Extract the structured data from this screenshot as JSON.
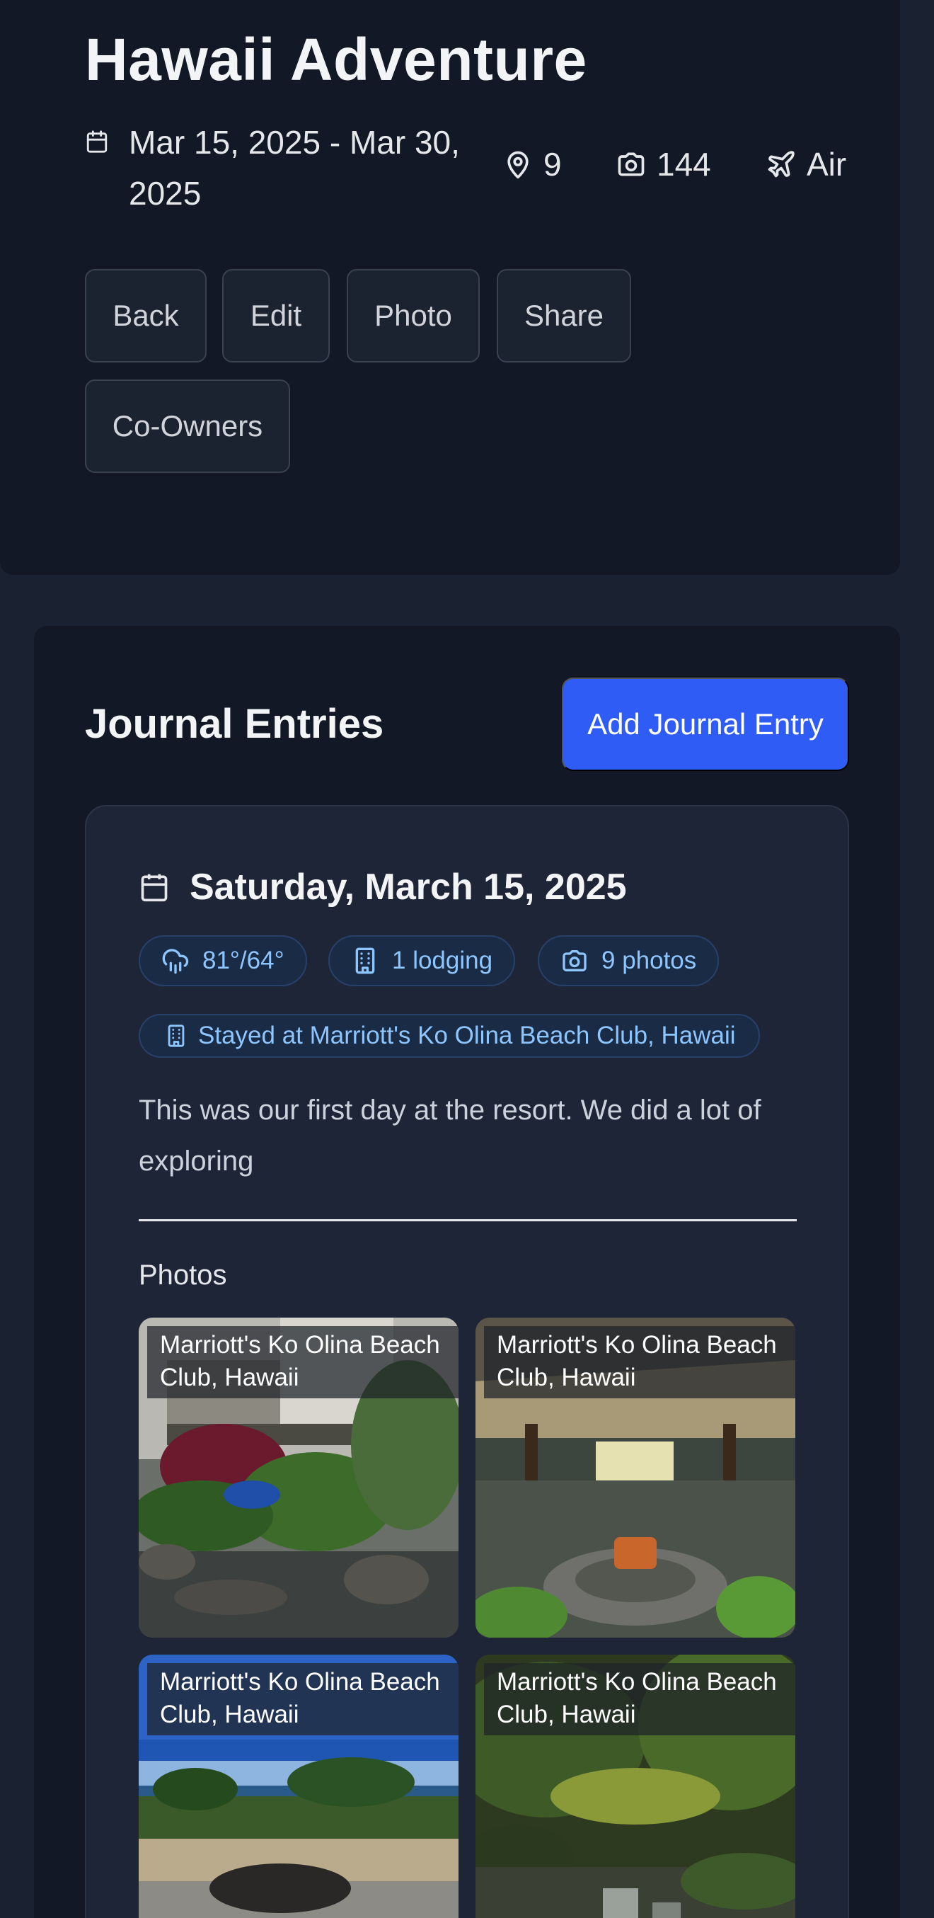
{
  "trip": {
    "title": "Hawaii Adventure",
    "dates": "Mar 15, 2025 - Mar 30, 2025",
    "locations_count": "9",
    "photos_count": "144",
    "transport": "Air"
  },
  "actions": {
    "back": "Back",
    "edit": "Edit",
    "photo": "Photo",
    "share": "Share",
    "co_owners": "Co-Owners"
  },
  "journal": {
    "heading": "Journal Entries",
    "add_button": "Add Journal Entry",
    "entries": [
      {
        "date": "Saturday, March 15, 2025",
        "weather": "81°/64°",
        "lodging_count": "1 lodging",
        "photos_count": "9 photos",
        "lodging": "Stayed at Marriott's Ko Olina Beach Club, Hawaii",
        "text": "This was our first day at the resort. We did a lot of exploring",
        "photos_label": "Photos",
        "photos": [
          {
            "caption": "Marriott's Ko Olina Beach Club, Hawaii"
          },
          {
            "caption": "Marriott's Ko Olina Beach Club, Hawaii"
          },
          {
            "caption": "Marriott's Ko Olina Beach Club, Hawaii"
          },
          {
            "caption": "Marriott's Ko Olina Beach Club, Hawaii"
          }
        ]
      }
    ]
  },
  "icons": {
    "calendar": "calendar-icon",
    "location": "map-pin-icon",
    "camera": "camera-icon",
    "transport": "plane-icon",
    "weather": "rain-cloud-icon",
    "lodging": "building-icon"
  },
  "colors": {
    "background": "#1a2232",
    "card": "#121826",
    "entry_card": "#1e2537",
    "accent": "#2f5cf5",
    "chip_text": "#8ec5ff"
  }
}
